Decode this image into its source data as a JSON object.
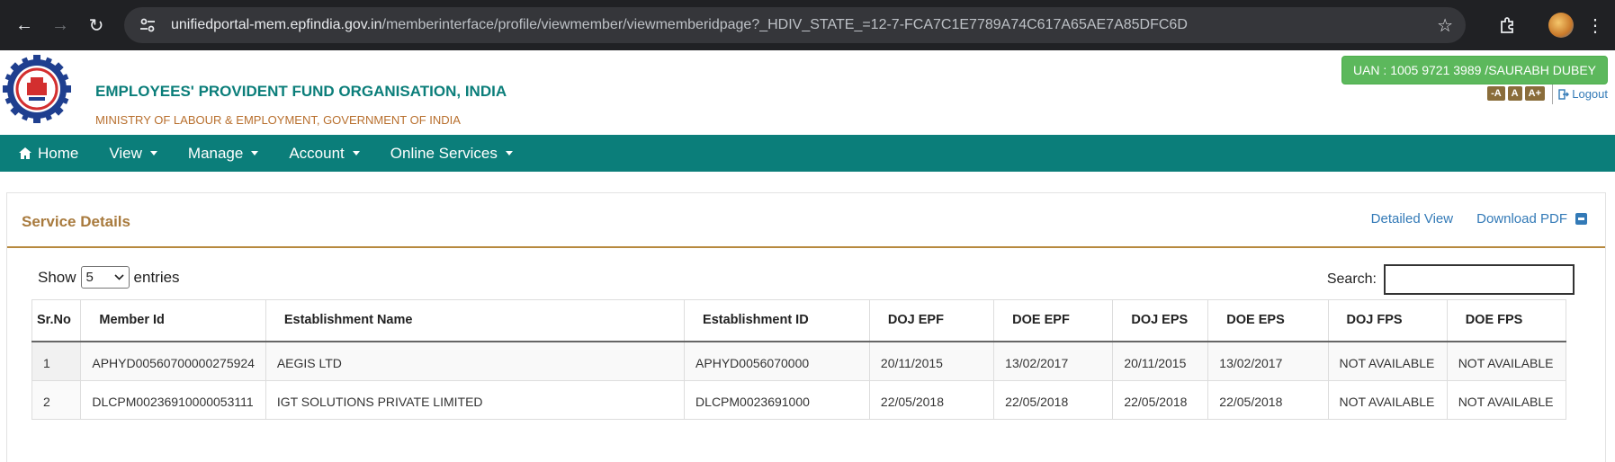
{
  "browser": {
    "url_host": "unifiedportal-mem.epfindia.gov.in",
    "url_path": "/memberinterface/profile/viewmember/viewmemberidpage?_HDIV_STATE_=12-7-FCA7C1E7789A74C617A65AE7A85DFC6D"
  },
  "header": {
    "org_name": "EMPLOYEES' PROVIDENT FUND ORGANISATION, INDIA",
    "ministry": "MINISTRY OF LABOUR & EMPLOYMENT, GOVERNMENT OF INDIA",
    "uan": "UAN : 1005 9721 3989 /SAURABH DUBEY",
    "font_small": "-A",
    "font_normal": "A",
    "font_large": "A+",
    "logout": "Logout"
  },
  "nav": {
    "home": "Home",
    "view": "View",
    "manage": "Manage",
    "account": "Account",
    "online_services": "Online Services"
  },
  "panel": {
    "title": "Service Details",
    "detailed_view": "Detailed View",
    "download_pdf": "Download PDF"
  },
  "controls": {
    "show": "Show",
    "entries_value": "5",
    "entries": "entries",
    "search_label": "Search:"
  },
  "table": {
    "headers": [
      "Sr.No",
      "Member Id",
      "Establishment Name",
      "Establishment ID",
      "DOJ EPF",
      "DOE EPF",
      "DOJ EPS",
      "DOE EPS",
      "DOJ FPS",
      "DOE FPS"
    ],
    "rows": [
      [
        "1",
        "APHYD00560700000275924",
        "AEGIS LTD",
        "APHYD0056070000",
        "20/11/2015",
        "13/02/2017",
        "20/11/2015",
        "13/02/2017",
        "NOT AVAILABLE",
        "NOT AVAILABLE"
      ],
      [
        "2",
        "DLCPM00236910000053111",
        "IGT SOLUTIONS PRIVATE LIMITED",
        "DLCPM0023691000",
        "22/05/2018",
        "22/05/2018",
        "22/05/2018",
        "22/05/2018",
        "NOT AVAILABLE",
        "NOT AVAILABLE"
      ]
    ]
  },
  "colors": {
    "brand_teal": "#0b7e7a",
    "accent_brown": "#a87a3d",
    "uan_green": "#5cb85c",
    "link_blue": "#337ab7"
  }
}
